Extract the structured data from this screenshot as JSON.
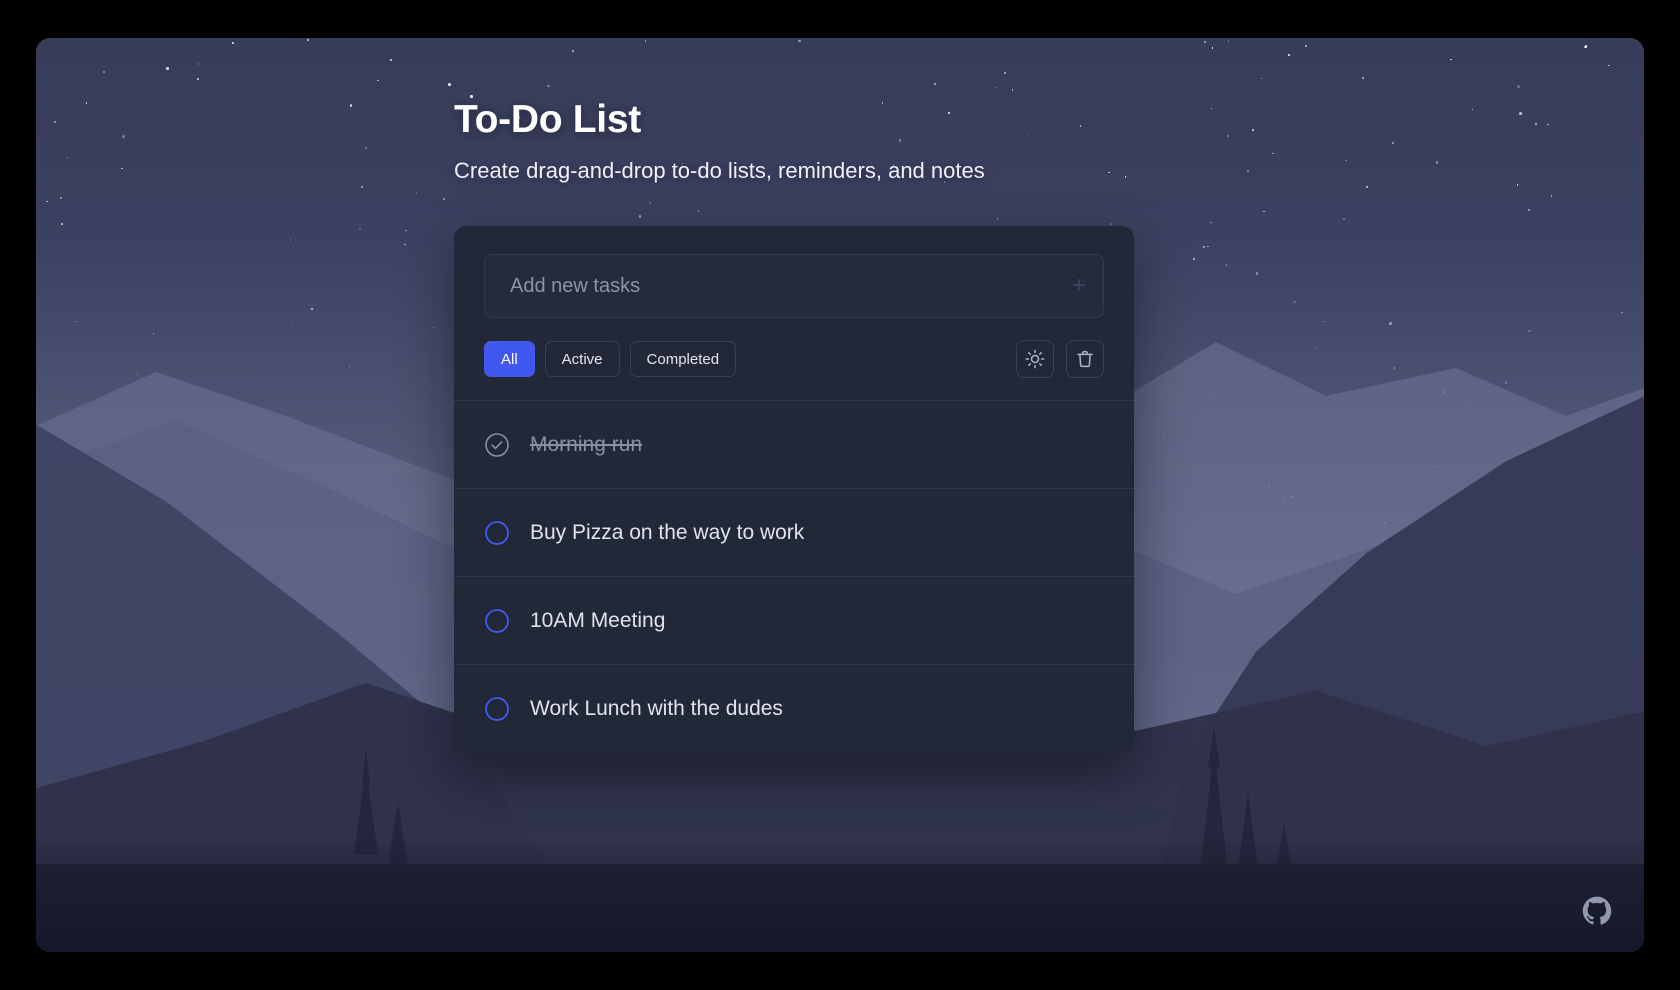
{
  "header": {
    "title": "To-Do List",
    "subtitle": "Create drag-and-drop to-do lists, reminders, and notes"
  },
  "input": {
    "placeholder": "Add new tasks",
    "value": "",
    "add_glyph": "+"
  },
  "filters": [
    {
      "label": "All",
      "active": true
    },
    {
      "label": "Active",
      "active": false
    },
    {
      "label": "Completed",
      "active": false
    }
  ],
  "actions": [
    {
      "name": "theme-toggle",
      "icon": "sun-icon"
    },
    {
      "name": "clear-all",
      "icon": "trash-icon"
    }
  ],
  "tasks": [
    {
      "label": "Morning run",
      "completed": true
    },
    {
      "label": "Buy Pizza on the way to work",
      "completed": false
    },
    {
      "label": "10AM Meeting",
      "completed": false
    },
    {
      "label": "Work Lunch with the dudes",
      "completed": false
    }
  ],
  "footer": {
    "github_icon": "github-icon"
  },
  "colors": {
    "accent": "#4058f0",
    "card_bg": "#232839",
    "input_bg": "#252a3c",
    "border": "#3a3f57",
    "text_primary": "#dfe3ee",
    "text_muted": "#8a8fa3",
    "page_bg": "#000000"
  }
}
